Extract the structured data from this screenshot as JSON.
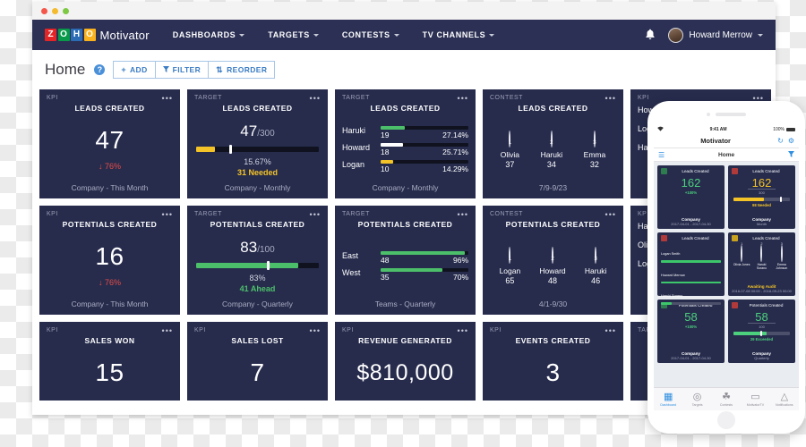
{
  "window": {
    "dots": [
      "red",
      "yellow",
      "green"
    ]
  },
  "navbar": {
    "logo_letters": [
      "Z",
      "O",
      "H",
      "O"
    ],
    "app_name": "Motivator",
    "items": [
      {
        "label": "DASHBOARDS",
        "caret": true
      },
      {
        "label": "TARGETS",
        "caret": true
      },
      {
        "label": "CONTESTS",
        "caret": true
      },
      {
        "label": "TV CHANNELS",
        "caret": true
      }
    ],
    "bell_icon": "ὑ4",
    "user": {
      "name": "Howard Merrow",
      "caret": true
    }
  },
  "page_header": {
    "title": "Home",
    "help_icon_label": "?",
    "buttons": [
      {
        "icon": "+",
        "label": "ADD"
      },
      {
        "icon": "▼",
        "label": "FILTER"
      },
      {
        "icon": "⇅",
        "label": "REORDER"
      }
    ]
  },
  "cards": [
    {
      "kind": "kpi",
      "type": "KPI",
      "title": "LEADS CREATED",
      "value": "47",
      "delta": "↓ 76%",
      "footer": "Company - This Month",
      "menu": "•••"
    },
    {
      "kind": "target",
      "type": "TARGET",
      "title": "LEADS CREATED",
      "current": "47",
      "denominator": "/300",
      "percent": "15.67%",
      "status": "31 Needed",
      "status_color": "#f3c328",
      "fill_pct": 15.67,
      "fill_color": "#f3c328",
      "marker_pct": 27,
      "footer": "Company - Monthly",
      "menu": "•••"
    },
    {
      "kind": "leaderboard",
      "type": "TARGET",
      "title": "LEADS CREATED",
      "rows": [
        {
          "name": "Haruki",
          "value": "19",
          "percent": "27.14%",
          "fill_pct": 27.14,
          "color": "#4cbf6a"
        },
        {
          "name": "Howard",
          "value": "18",
          "percent": "25.71%",
          "fill_pct": 25.71,
          "color": "#ffffff"
        },
        {
          "name": "Logan",
          "value": "10",
          "percent": "14.29%",
          "fill_pct": 14.29,
          "color": "#f3c328"
        }
      ],
      "footer": "Company - Monthly",
      "menu": "•••"
    },
    {
      "kind": "contest",
      "type": "CONTEST",
      "title": "LEADS CREATED",
      "people": [
        {
          "rank": "1",
          "name": "Olivia",
          "score": "37",
          "color1": "#c9a18b",
          "color2": "#6e4a3b"
        },
        {
          "rank": "2",
          "name": "Haruki",
          "score": "34",
          "color1": "#d8b49a",
          "color2": "#44372f"
        },
        {
          "rank": "3",
          "name": "Emma",
          "score": "32",
          "color1": "#d5a690",
          "color2": "#5a3328"
        }
      ],
      "footer": "7/9-9/23",
      "menu": "•••"
    },
    {
      "kind": "partial",
      "type": "KPI",
      "title": "",
      "names": [
        "How",
        "Loga",
        "Haru"
      ],
      "menu": "•••"
    },
    {
      "kind": "kpi",
      "type": "KPI",
      "title": "POTENTIALS CREATED",
      "value": "16",
      "delta": "↓ 76%",
      "footer": "Company - This Month",
      "menu": "•••"
    },
    {
      "kind": "target",
      "type": "TARGET",
      "title": "POTENTIALS CREATED",
      "current": "83",
      "denominator": "/100",
      "percent": "83%",
      "status": "41 Ahead",
      "status_color": "#4cbf6a",
      "fill_pct": 83,
      "fill_color": "#4cbf6a",
      "marker_pct": 58,
      "footer": "Company - Quarterly",
      "menu": "•••"
    },
    {
      "kind": "leaderboard",
      "type": "TARGET",
      "title": "POTENTIALS CREATED",
      "rows": [
        {
          "name": "East",
          "value": "48",
          "percent": "96%",
          "fill_pct": 96,
          "color": "#4cbf6a"
        },
        {
          "name": "West",
          "value": "35",
          "percent": "70%",
          "fill_pct": 70,
          "color": "#4cbf6a"
        }
      ],
      "footer": "Teams - Quarterly",
      "menu": "•••"
    },
    {
      "kind": "contest",
      "type": "CONTEST",
      "title": "POTENTIALS CREATED",
      "people": [
        {
          "rank": "1",
          "name": "Logan",
          "score": "65",
          "color1": "#caa58c",
          "color2": "#4a3328"
        },
        {
          "rank": "2",
          "name": "Howard",
          "score": "48",
          "color1": "#d2a98f",
          "color2": "#3a2b22"
        },
        {
          "rank": "3",
          "name": "Haruki",
          "score": "46",
          "color1": "#d8b197",
          "color2": "#3d3027"
        }
      ],
      "footer": "4/1-9/30",
      "menu": "•••"
    },
    {
      "kind": "partial",
      "type": "KPI",
      "title": "",
      "names": [
        "Haru",
        "Olivi",
        "Loga"
      ],
      "menu": "•••"
    },
    {
      "kind": "kpi-short",
      "type": "KPI",
      "title": "SALES WON",
      "value": "15",
      "menu": "•••"
    },
    {
      "kind": "kpi-short",
      "type": "KPI",
      "title": "SALES LOST",
      "value": "7",
      "menu": "•••"
    },
    {
      "kind": "kpi-short",
      "type": "KPI",
      "title": "REVENUE GENERATED",
      "value": "$810,000",
      "menu": "•••"
    },
    {
      "kind": "kpi-short",
      "type": "KPI",
      "title": "EVENTS CREATED",
      "value": "3",
      "menu": "•••"
    },
    {
      "kind": "partial-short",
      "type": "TARG",
      "title": "",
      "menu": "•••"
    }
  ],
  "phone": {
    "status": {
      "wifi": "▲",
      "time": "9:41 AM",
      "battery_label": "100%"
    },
    "titlebar": {
      "title": "Motivator",
      "refresh_icon": "↻",
      "settings_icon": "⚙"
    },
    "subbar": {
      "menu_icon": "☰",
      "title": "Home",
      "filter_icon": "▼"
    },
    "cards": [
      {
        "kind": "kpi",
        "icon_color": "#2e7d4f",
        "title": "Leads Created",
        "value": "162",
        "value_color": "#4cd07d",
        "delta": "+100%",
        "delta_color": "#4cd07d",
        "foot_a": "Company",
        "foot_b": "2017-04-01 - 2017-04-30"
      },
      {
        "kind": "target",
        "icon_color": "#b03a3a",
        "title": "Leads Created",
        "value": "162",
        "value_color": "#f3c328",
        "denominator": "300",
        "status": "98 Needed",
        "status_color": "#f3c328",
        "fill_pct": 54,
        "fill_color": "#f3c328",
        "marker_pct": 83,
        "foot_a": "Company",
        "foot_b": "Month"
      },
      {
        "kind": "leaderboard",
        "icon_color": "#b03a3a",
        "title": "Leads Created",
        "rows": [
          {
            "name": "Logan Smith",
            "fill_pct": 100
          },
          {
            "name": "Howard Merrow",
            "fill_pct": 100
          },
          {
            "name": "Haruki Sorano",
            "fill_pct": 18
          }
        ],
        "foot_a": "Company",
        "foot_b": "Month"
      },
      {
        "kind": "contest",
        "icon_color": "#c8a21f",
        "title": "Leads Created",
        "people": [
          {
            "rank": "1",
            "name": "Olivia Jones",
            "color1": "#c9a18b",
            "color2": "#6e4a3b"
          },
          {
            "rank": "2",
            "name": "Haruki Sorano",
            "color1": "#d8b49a",
            "color2": "#44372f"
          },
          {
            "rank": "3",
            "name": "Emma Johnson",
            "color1": "#d5a690",
            "color2": "#5a3328"
          }
        ],
        "foot_a": "Awaiting Audit",
        "foot_b": "2016-07-08 00:00 - 2016-09-23 00:00"
      },
      {
        "kind": "kpi",
        "icon_color": "#2e7d4f",
        "title": "Potentials Created",
        "value": "58",
        "value_color": "#4cd07d",
        "delta": "+100%",
        "delta_color": "#4cd07d",
        "foot_a": "Company",
        "foot_b": "2017-04-01 - 2017-04-30"
      },
      {
        "kind": "target",
        "icon_color": "#b03a3a",
        "title": "Potentials Created",
        "value": "58",
        "value_color": "#4cd07d",
        "denominator": "100",
        "status": "29 Exceeded",
        "status_color": "#4cd07d",
        "fill_pct": 58,
        "fill_color": "#4cd07d",
        "marker_pct": 48,
        "foot_a": "Company",
        "foot_b": "Quarterly"
      }
    ],
    "tabs": [
      {
        "glyph": "▦",
        "label": "Dashboard",
        "active": true
      },
      {
        "glyph": "◎",
        "label": "Targets",
        "active": false
      },
      {
        "glyph": "☘",
        "label": "Contests",
        "active": false
      },
      {
        "glyph": "▭",
        "label": "MotivatorTV",
        "active": false
      },
      {
        "glyph": "△",
        "label": "Notifications",
        "active": false
      }
    ]
  }
}
